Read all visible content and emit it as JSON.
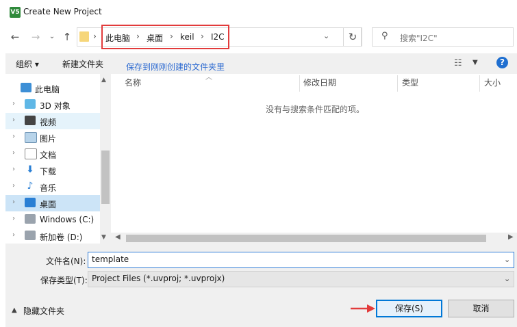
{
  "window": {
    "title": "Create New Project",
    "app_icon_text": "V5"
  },
  "address": {
    "crumbs": [
      "此电脑",
      "桌面",
      "keil",
      "I2C"
    ]
  },
  "search": {
    "placeholder": "搜索\"I2C\""
  },
  "toolbar": {
    "organize_label": "组织 ▾",
    "new_folder_label": "新建文件夹",
    "annotation": "保存到刚刚创建的文件夹里"
  },
  "nav_pane": {
    "items": [
      {
        "label": "此电脑",
        "icon": "computer-icon",
        "state": "normal"
      },
      {
        "label": "3D 对象",
        "icon": "cube-icon",
        "state": "normal"
      },
      {
        "label": "视频",
        "icon": "video-icon",
        "state": "hover"
      },
      {
        "label": "图片",
        "icon": "pictures-icon",
        "state": "normal"
      },
      {
        "label": "文档",
        "icon": "documents-icon",
        "state": "normal"
      },
      {
        "label": "下载",
        "icon": "download-icon",
        "state": "normal"
      },
      {
        "label": "音乐",
        "icon": "music-icon",
        "state": "normal"
      },
      {
        "label": "桌面",
        "icon": "desktop-icon",
        "state": "selected"
      },
      {
        "label": "Windows (C:)",
        "icon": "drive-icon",
        "state": "normal"
      },
      {
        "label": "新加卷 (D:)",
        "icon": "drive-icon",
        "state": "normal"
      }
    ]
  },
  "columns": [
    "名称",
    "修改日期",
    "类型",
    "大小"
  ],
  "empty_message": "没有与搜索条件匹配的项。",
  "form": {
    "filename_label": "文件名(N):",
    "filename_value": "template",
    "filetype_label": "保存类型(T):",
    "filetype_value": "Project Files (*.uvproj; *.uvprojx)",
    "hide_folders_label": "隐藏文件夹"
  },
  "buttons": {
    "save": "保存(S)",
    "cancel": "取消"
  },
  "colors": {
    "highlight_box": "#e23b3b",
    "annotation_text": "#2e6bd1",
    "selection": "#cce4f7",
    "primary_border": "#0078d7"
  }
}
